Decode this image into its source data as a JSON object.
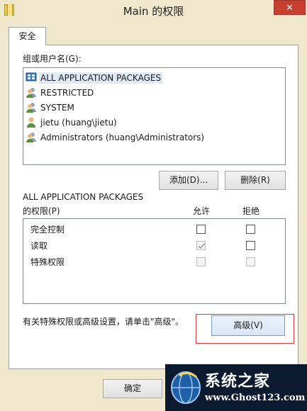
{
  "window": {
    "title": "Main 的权限",
    "close_label": "✕"
  },
  "tabs": [
    {
      "label": "安全"
    }
  ],
  "groups": {
    "label": "组或用户名(G):",
    "items": [
      {
        "label": "ALL APPLICATION PACKAGES",
        "icon": "app-packages-icon"
      },
      {
        "label": "RESTRICTED",
        "icon": "group-users-icon"
      },
      {
        "label": "SYSTEM",
        "icon": "group-users-icon"
      },
      {
        "label": "jietu (huang\\jietu)",
        "icon": "user-icon"
      },
      {
        "label": "Administrators (huang\\Administrators)",
        "icon": "group-users-icon"
      }
    ],
    "selected_index": 0
  },
  "buttons": {
    "add": "添加(D)...",
    "remove": "删除(R)",
    "advanced": "高级(V)",
    "ok": "确定"
  },
  "permissions": {
    "subject": "ALL APPLICATION PACKAGES",
    "label": "的权限(P)",
    "allow_header": "允许",
    "deny_header": "拒绝",
    "rows": [
      {
        "name": "完全控制",
        "allow": false,
        "deny": false,
        "disabled": false
      },
      {
        "name": "读取",
        "allow": true,
        "deny": false,
        "disabled": false,
        "allow_disabled": true
      },
      {
        "name": "特殊权限",
        "allow": false,
        "deny": false,
        "disabled": true
      }
    ]
  },
  "advanced_hint": "有关特殊权限或高级设置，请单击\"高级\"。",
  "watermark": {
    "title": "系统之家",
    "url": "www.Ghost123.com"
  },
  "colors": {
    "background": "#f0e8cc",
    "close": "#c7402f",
    "highlight": "#e0393e",
    "selection": "#dfe9f7"
  }
}
